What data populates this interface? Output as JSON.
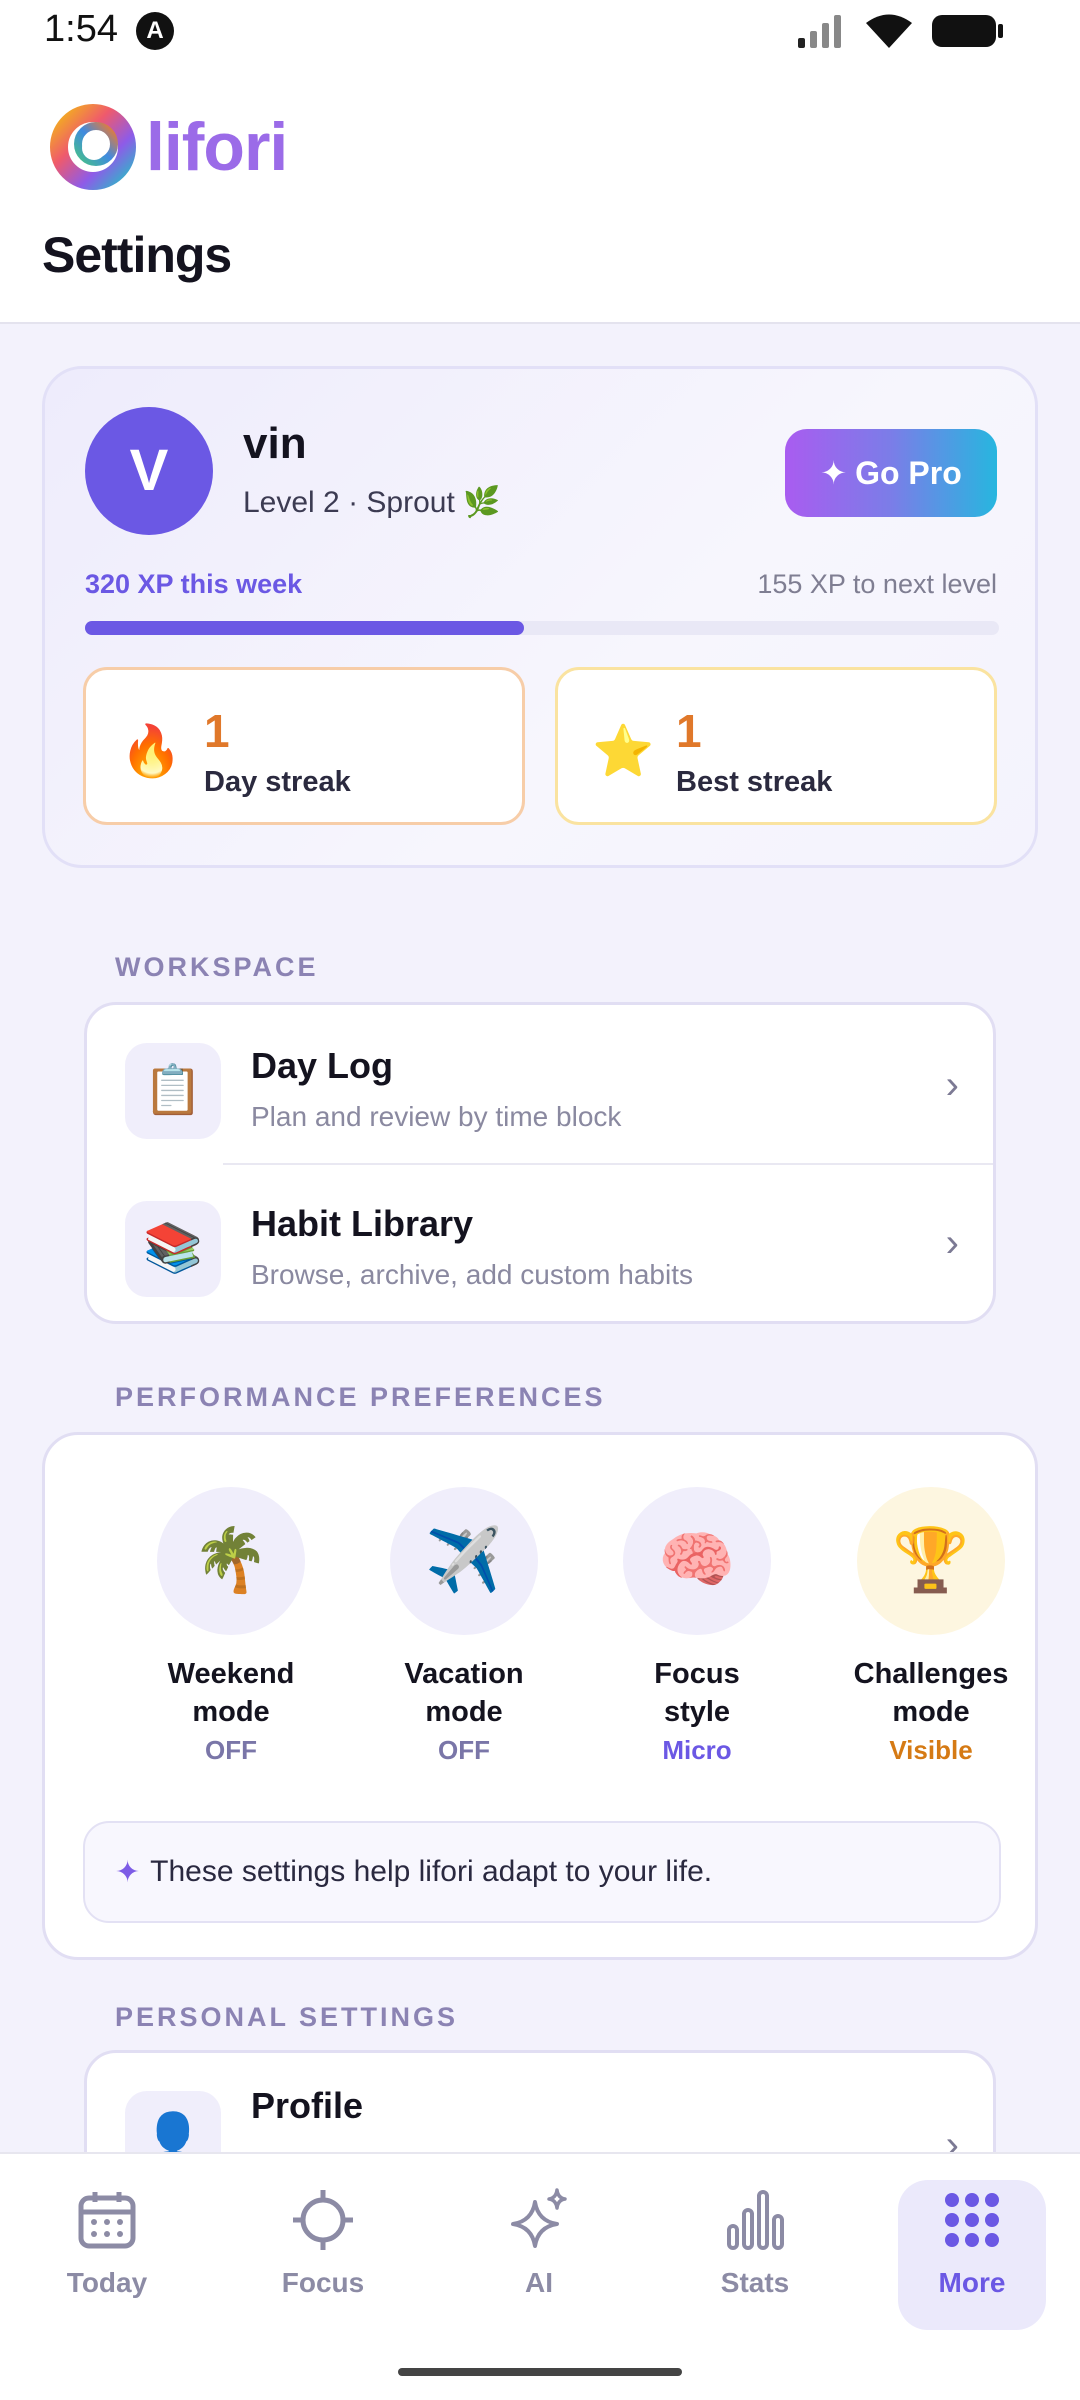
{
  "status_bar": {
    "time": "1:54",
    "notif_letter": "A"
  },
  "header": {
    "logo_text": "lifori",
    "page_title": "Settings"
  },
  "profile": {
    "avatar_letter": "V",
    "name": "vin",
    "level_text": "Level 2 · Sprout 🌿",
    "go_pro_label": "Go Pro",
    "go_pro_icon": "✦",
    "xp_week": "320 XP this week",
    "xp_next": "155 XP to next level",
    "xp_progress_fraction": 0.48,
    "accent_color": "#6b58e4",
    "day_streak": {
      "icon": "🔥",
      "value": "1",
      "label": "Day streak"
    },
    "best_streak": {
      "icon": "⭐",
      "value": "1",
      "label": "Best streak"
    }
  },
  "workspace": {
    "section_label": "WORKSPACE",
    "items": [
      {
        "icon": "📋",
        "title": "Day Log",
        "subtitle": "Plan and review by time block",
        "chevron": "›"
      },
      {
        "icon": "📚",
        "title": "Habit Library",
        "subtitle": "Browse, archive, add custom habits",
        "chevron": "›"
      }
    ]
  },
  "performance": {
    "section_label": "PERFORMANCE PREFERENCES",
    "items": [
      {
        "icon": "🌴",
        "line1": "Weekend",
        "line2": "mode",
        "value": "OFF"
      },
      {
        "icon": "✈️",
        "line1": "Vacation",
        "line2": "mode",
        "value": "OFF"
      },
      {
        "icon": "🧠",
        "line1": "Focus",
        "line2": "style",
        "value": "Micro"
      },
      {
        "icon": "🏆",
        "line1": "Challenges",
        "line2": "mode",
        "value": "Visible"
      }
    ],
    "note_icon": "✦",
    "note": "These settings help lifori adapt to your life."
  },
  "personal": {
    "section_label": "PERSONAL SETTINGS",
    "items": [
      {
        "icon": "👤",
        "title": "Profile",
        "chevron": "›"
      }
    ]
  },
  "tabs": [
    {
      "label": "Today",
      "icon": "calendar-icon"
    },
    {
      "label": "Focus",
      "icon": "target-icon"
    },
    {
      "label": "AI",
      "icon": "sparkles-icon"
    },
    {
      "label": "Stats",
      "icon": "bar-chart-icon"
    },
    {
      "label": "More",
      "icon": "grid-dots-icon",
      "active": true
    }
  ]
}
